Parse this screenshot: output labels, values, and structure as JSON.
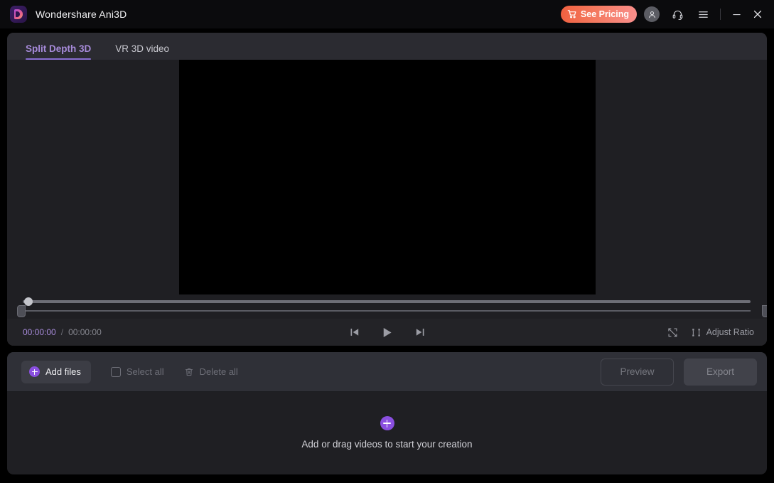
{
  "window": {
    "app_title": "Wondershare Ani3D",
    "logo_icon": "ani3d-logo-icon",
    "accent_purple": "#8a4fe0",
    "tab_active_color": "#a78bda",
    "pricing_gradient_from": "#f0603f",
    "pricing_gradient_to": "#f98f8d"
  },
  "titlebar": {
    "pricing_label": "See Pricing",
    "cart_icon": "shopping-cart-icon",
    "account_icon": "user-avatar-icon",
    "support_icon": "headset-icon",
    "menu_icon": "hamburger-menu-icon",
    "minimize_icon": "minimize-icon",
    "close_icon": "close-icon"
  },
  "tabs": [
    {
      "label": "Split Depth 3D",
      "active": true
    },
    {
      "label": "VR 3D video",
      "active": false
    }
  ],
  "player": {
    "current_time": "00:00:00",
    "separator": "/",
    "total_time": "00:00:00",
    "prev_frame_icon": "previous-frame-icon",
    "play_icon": "play-icon",
    "next_frame_icon": "next-frame-icon",
    "fullscreen_icon": "fullscreen-icon",
    "adjust_ratio_icon": "adjust-ratio-icon",
    "adjust_ratio_label": "Adjust Ratio",
    "progress_percent": 0,
    "trim_start_percent": 0,
    "trim_end_percent": 100
  },
  "file_toolbar": {
    "add_files_label": "Add files",
    "add_files_icon": "plus-circle-icon",
    "select_all_label": "Select all",
    "select_all_icon": "checkbox-icon",
    "delete_all_label": "Delete all",
    "delete_all_icon": "trash-icon",
    "preview_label": "Preview",
    "export_label": "Export"
  },
  "dropzone": {
    "plus_icon": "plus-circle-icon",
    "hint_text": "Add or drag videos to start your creation"
  }
}
